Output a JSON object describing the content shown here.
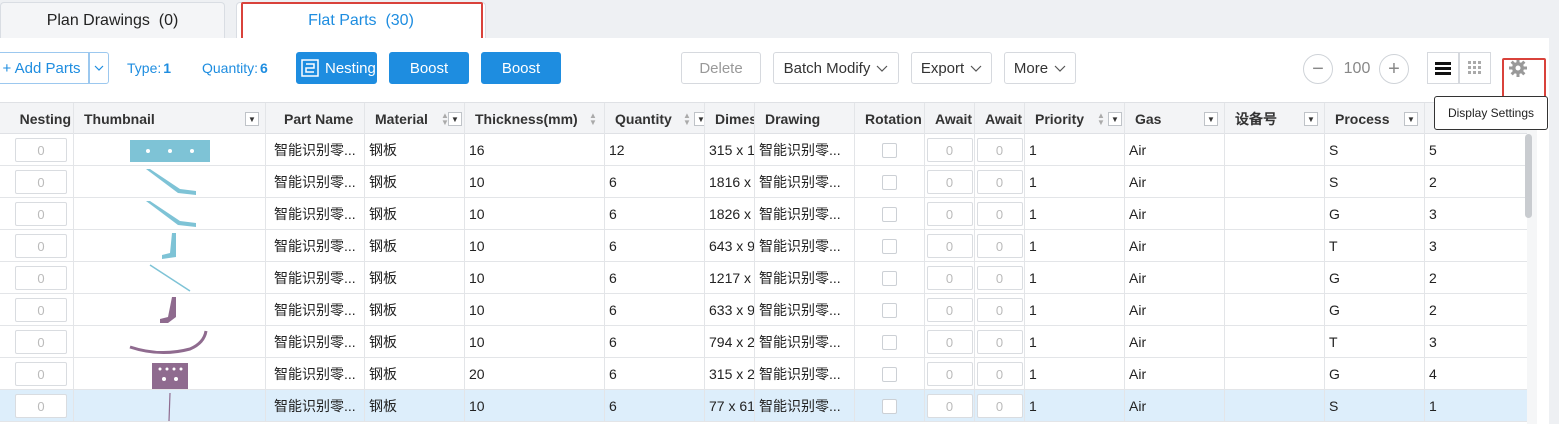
{
  "tabs": [
    {
      "label": "Plan Drawings",
      "count": "(0)"
    },
    {
      "label": "Flat Parts",
      "count": "(30)"
    }
  ],
  "toolbar": {
    "add_parts": "+ Add Parts",
    "type_label": "Type:",
    "type_value": "1",
    "quantity_label": "Quantity:",
    "quantity_value": "6",
    "nesting": "Nesting",
    "boost1": "Boost",
    "boost2": "Boost",
    "delete": "Delete",
    "batch_modify": "Batch Modify",
    "export": "Export",
    "more": "More",
    "zoom_minus": "−",
    "zoom_value": "100",
    "zoom_plus": "+"
  },
  "tooltip": "Display Settings",
  "columns": [
    "Nesting",
    "Thumbnail",
    "Part Name",
    "Material",
    "Thickness(mm)",
    "Quantity",
    "Dimes",
    "Drawing",
    "Rotation",
    "Await",
    "Await",
    "Priority",
    "Gas",
    "设备号",
    "Process",
    ""
  ],
  "rows": [
    {
      "nesting": "0",
      "part": "智能识别零...",
      "material": "钢板",
      "thickness": "16",
      "quantity": "12",
      "dim": "315 x 1",
      "drawing": "智能识别零...",
      "await1": "0",
      "await2": "0",
      "priority": "1",
      "gas": "Air",
      "device": "",
      "process": "S",
      "last": "5",
      "thumb": "plate",
      "selected": false
    },
    {
      "nesting": "0",
      "part": "智能识别零...",
      "material": "钢板",
      "thickness": "10",
      "quantity": "6",
      "dim": "1816 x",
      "drawing": "智能识别零...",
      "await1": "0",
      "await2": "0",
      "priority": "1",
      "gas": "Air",
      "device": "",
      "process": "S",
      "last": "2",
      "thumb": "slash",
      "selected": false
    },
    {
      "nesting": "0",
      "part": "智能识别零...",
      "material": "钢板",
      "thickness": "10",
      "quantity": "6",
      "dim": "1826 x",
      "drawing": "智能识别零...",
      "await1": "0",
      "await2": "0",
      "priority": "1",
      "gas": "Air",
      "device": "",
      "process": "G",
      "last": "3",
      "thumb": "slash",
      "selected": false
    },
    {
      "nesting": "0",
      "part": "智能识别零...",
      "material": "钢板",
      "thickness": "10",
      "quantity": "6",
      "dim": "643 x 9",
      "drawing": "智能识别零...",
      "await1": "0",
      "await2": "0",
      "priority": "1",
      "gas": "Air",
      "device": "",
      "process": "T",
      "last": "3",
      "thumb": "hook",
      "selected": false
    },
    {
      "nesting": "0",
      "part": "智能识别零...",
      "material": "钢板",
      "thickness": "10",
      "quantity": "6",
      "dim": "1217 x",
      "drawing": "智能识别零...",
      "await1": "0",
      "await2": "0",
      "priority": "1",
      "gas": "Air",
      "device": "",
      "process": "G",
      "last": "2",
      "thumb": "thin",
      "selected": false
    },
    {
      "nesting": "0",
      "part": "智能识别零...",
      "material": "钢板",
      "thickness": "10",
      "quantity": "6",
      "dim": "633 x 9",
      "drawing": "智能识别零...",
      "await1": "0",
      "await2": "0",
      "priority": "1",
      "gas": "Air",
      "device": "",
      "process": "G",
      "last": "2",
      "thumb": "hook-purple",
      "selected": false
    },
    {
      "nesting": "0",
      "part": "智能识别零...",
      "material": "钢板",
      "thickness": "10",
      "quantity": "6",
      "dim": "794 x 2",
      "drawing": "智能识别零...",
      "await1": "0",
      "await2": "0",
      "priority": "1",
      "gas": "Air",
      "device": "",
      "process": "T",
      "last": "3",
      "thumb": "arc",
      "selected": false
    },
    {
      "nesting": "0",
      "part": "智能识别零...",
      "material": "钢板",
      "thickness": "20",
      "quantity": "6",
      "dim": "315 x 2",
      "drawing": "智能识别零...",
      "await1": "0",
      "await2": "0",
      "priority": "1",
      "gas": "Air",
      "device": "",
      "process": "G",
      "last": "4",
      "thumb": "block",
      "selected": false
    },
    {
      "nesting": "0",
      "part": "智能识别零...",
      "material": "钢板",
      "thickness": "10",
      "quantity": "6",
      "dim": "77 x 61",
      "drawing": "智能识别零...",
      "await1": "0",
      "await2": "0",
      "priority": "1",
      "gas": "Air",
      "device": "",
      "process": "S",
      "last": "1",
      "thumb": "line",
      "selected": true
    }
  ]
}
